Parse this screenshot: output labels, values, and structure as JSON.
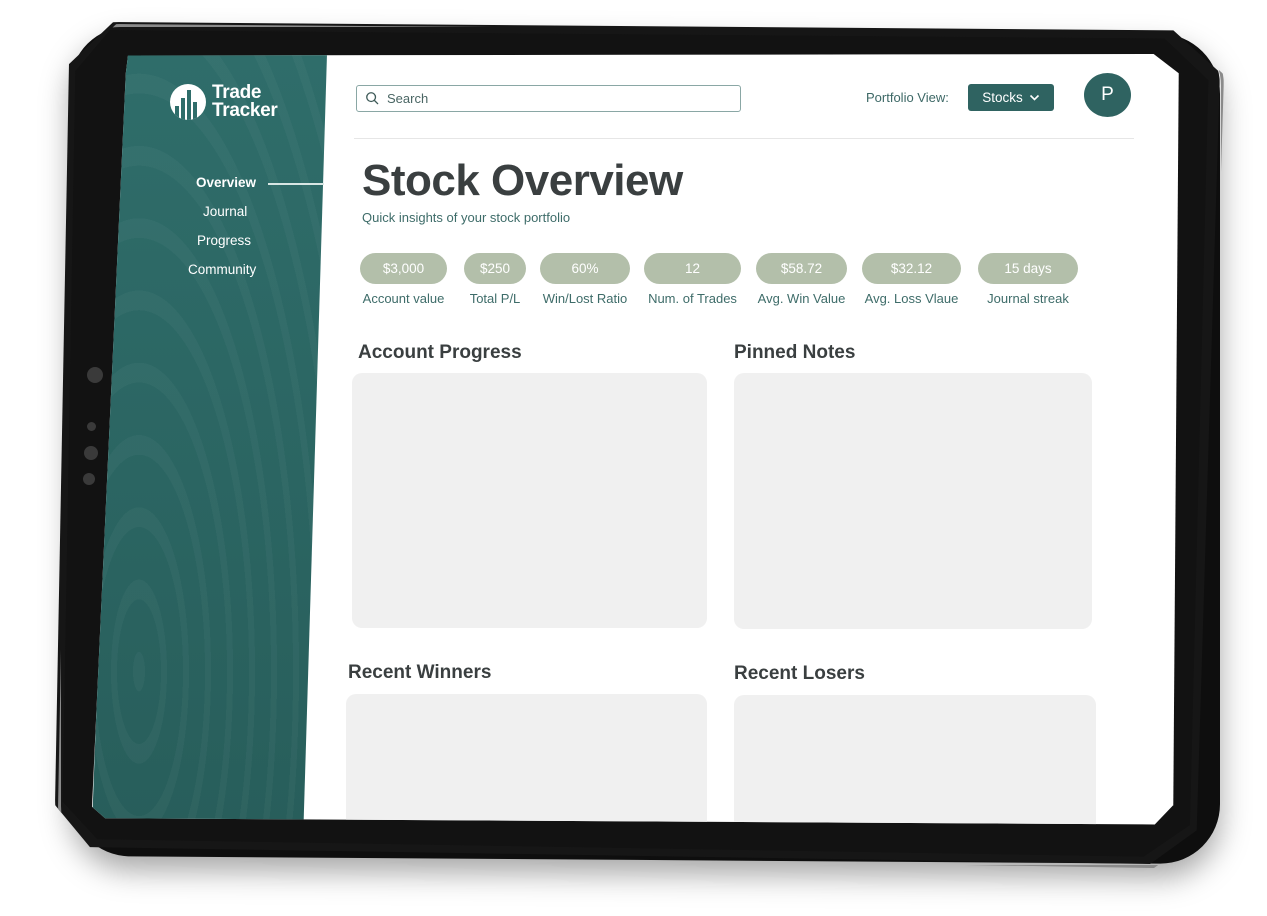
{
  "app": {
    "logo_line1": "Trade",
    "logo_line2": "Tracker"
  },
  "sidebar": {
    "items": [
      {
        "label": "Overview",
        "active": true
      },
      {
        "label": "Journal",
        "active": false
      },
      {
        "label": "Progress",
        "active": false
      },
      {
        "label": "Community",
        "active": false
      }
    ]
  },
  "header": {
    "search_placeholder": "Search",
    "portfolio_label": "Portfolio View:",
    "portfolio_value": "Stocks",
    "avatar_initial": "P"
  },
  "main": {
    "title": "Stock Overview",
    "subtitle": "Quick insights of your stock portfolio",
    "stats": [
      {
        "value": "$3,000",
        "label": "Account value"
      },
      {
        "value": "$250",
        "label": "Total P/L"
      },
      {
        "value": "60%",
        "label": "Win/Lost Ratio"
      },
      {
        "value": "12",
        "label": "Num. of Trades"
      },
      {
        "value": "$58.72",
        "label": "Avg. Win Value"
      },
      {
        "value": "$32.12",
        "label": "Avg. Loss Vlaue"
      },
      {
        "value": "15 days",
        "label": "Journal streak"
      }
    ],
    "sections": {
      "account_progress": "Account Progress",
      "pinned_notes": "Pinned Notes",
      "recent_winners": "Recent Winners",
      "recent_losers": "Recent Losers"
    }
  },
  "colors": {
    "sidebar": "#2f6d6a",
    "accent": "#2f6361",
    "pill": "#b3bfaa",
    "card": "#f0f0f0"
  }
}
